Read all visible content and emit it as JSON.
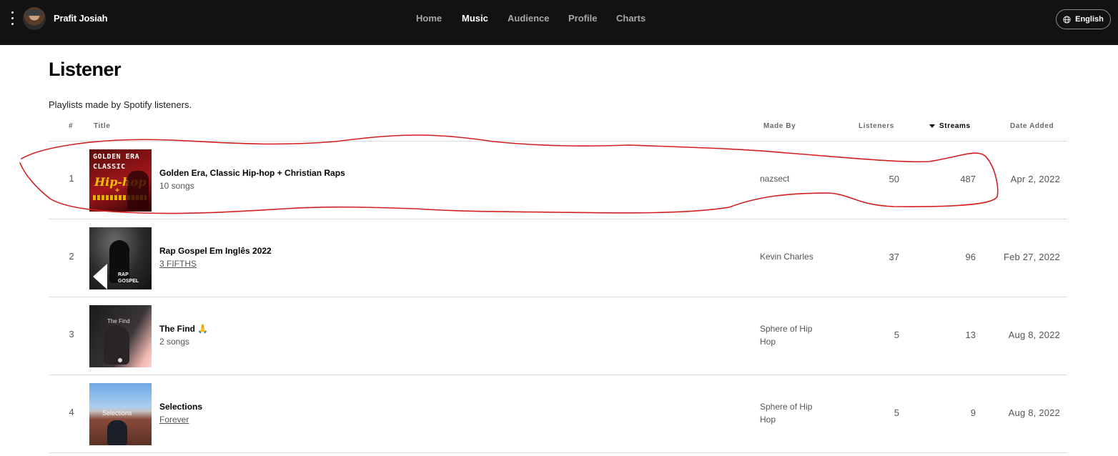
{
  "header": {
    "artist_name": "Prafit Josiah",
    "nav": [
      {
        "label": "Home",
        "active": false
      },
      {
        "label": "Music",
        "active": true
      },
      {
        "label": "Audience",
        "active": false
      },
      {
        "label": "Profile",
        "active": false
      },
      {
        "label": "Charts",
        "active": false
      }
    ],
    "language_label": "English",
    "icons": {
      "menu": "vertical-dots-icon",
      "language": "globe-icon"
    }
  },
  "page": {
    "title": "Listener",
    "subtitle": "Playlists made by Spotify listeners."
  },
  "table": {
    "columns": {
      "num": "#",
      "title": "Title",
      "made_by": "Made By",
      "listeners": "Listeners",
      "streams": "Streams",
      "date_added": "Date Added"
    },
    "sorted_by": "Streams",
    "sort_direction": "descending",
    "rows": [
      {
        "num": "1",
        "title": "Golden Era, Classic Hip-hop + Christian Raps",
        "subtitle": "10 songs",
        "subtitle_link": false,
        "made_by": "nazsect",
        "listeners": "50",
        "streams": "487",
        "date": "Apr 2, 2022",
        "cover_text": {
          "line1": "GOLDEN ERA",
          "line2": "CLASSIC",
          "line3": "Hip-hop",
          "line4": "+"
        }
      },
      {
        "num": "2",
        "title": "Rap Gospel Em Inglês 2022",
        "subtitle": "3 FIFTHS",
        "subtitle_link": true,
        "made_by": "Kevin Charles",
        "listeners": "37",
        "streams": "96",
        "date": "Feb 27, 2022",
        "cover_text": {
          "line1": "RAP",
          "line2": "GOSPEL"
        }
      },
      {
        "num": "3",
        "title": "The Find 🙏",
        "subtitle": "2 songs",
        "subtitle_link": false,
        "made_by": "Sphere of Hip Hop",
        "listeners": "5",
        "streams": "13",
        "date": "Aug 8, 2022",
        "cover_text": {
          "line1": "The Find"
        }
      },
      {
        "num": "4",
        "title": "Selections",
        "subtitle": "Forever",
        "subtitle_link": true,
        "made_by": "Sphere of Hip Hop",
        "listeners": "5",
        "streams": "9",
        "date": "Aug 8, 2022",
        "cover_text": {
          "line1": "Selections"
        }
      }
    ]
  },
  "colors": {
    "header_bg": "#121212",
    "annotation": "#d31f1f",
    "active_nav": "#ffffff",
    "inactive_nav": "#a7a7a7"
  }
}
